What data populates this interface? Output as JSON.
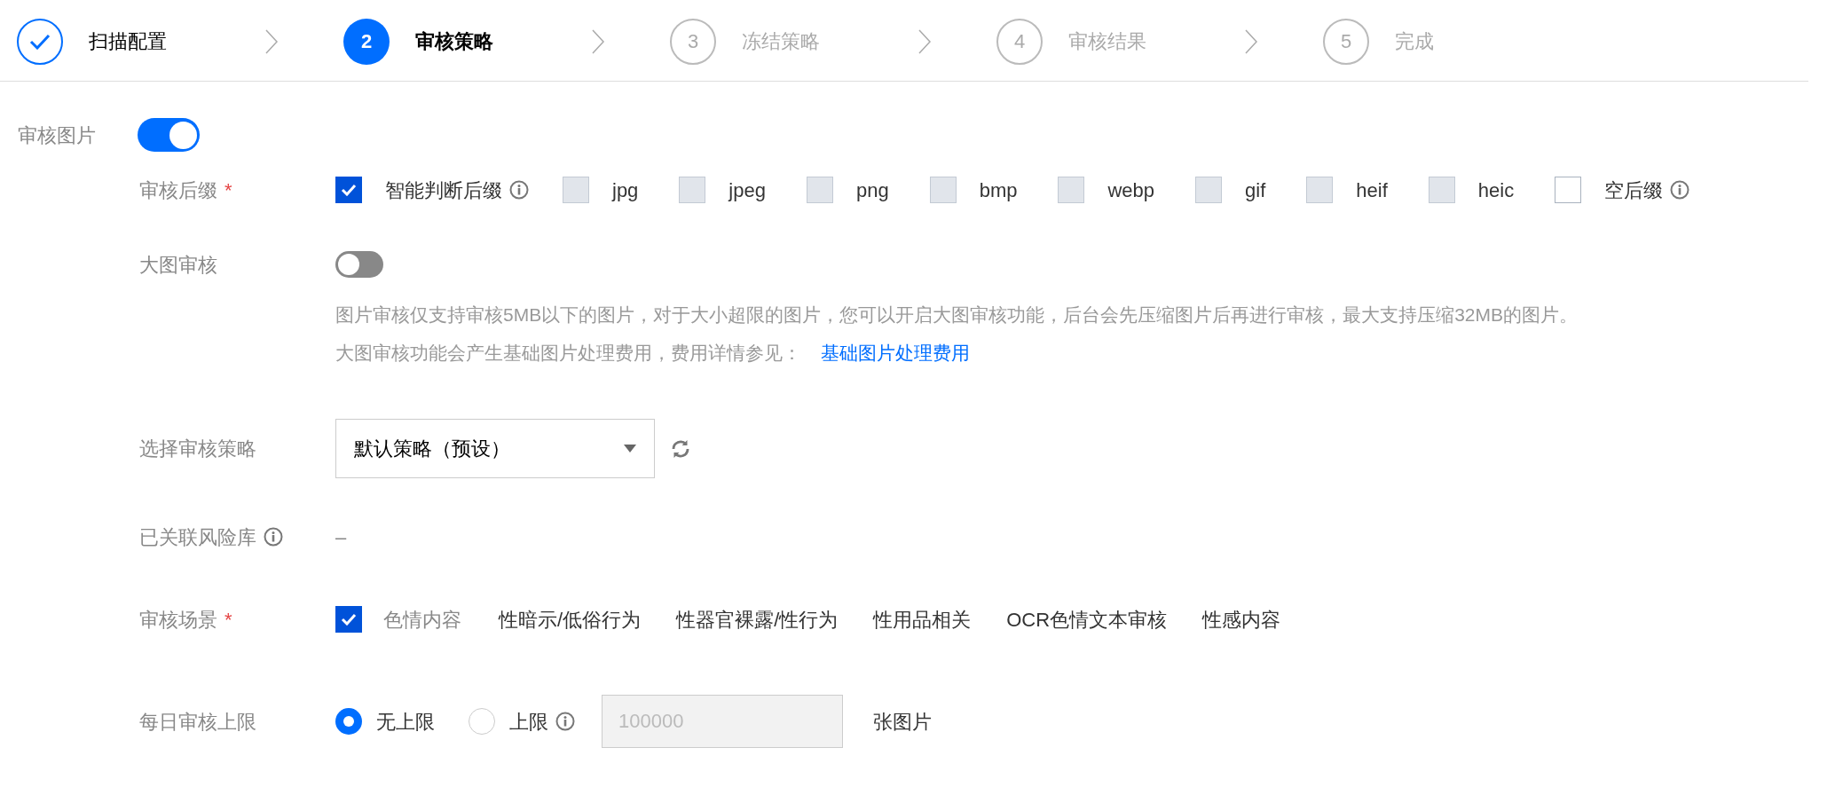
{
  "steps": [
    {
      "label": "扫描配置",
      "done": true,
      "selected": false
    },
    {
      "number": "2",
      "label": "审核策略",
      "done": false,
      "selected": true
    },
    {
      "number": "3",
      "label": "冻结策略",
      "done": false,
      "selected": false
    },
    {
      "number": "4",
      "label": "审核结果",
      "done": false,
      "selected": false
    },
    {
      "number": "5",
      "label": "完成",
      "done": false,
      "selected": false
    }
  ],
  "section": {
    "label": "审核图片",
    "on": true
  },
  "suffix": {
    "label": "审核后缀",
    "required": "*",
    "options": [
      {
        "label": "智能判断后缀",
        "checked": true,
        "disabled": false,
        "info": true
      },
      {
        "label": "jpg",
        "checked": false,
        "disabled": true,
        "info": false
      },
      {
        "label": "jpeg",
        "checked": false,
        "disabled": true,
        "info": false
      },
      {
        "label": "png",
        "checked": false,
        "disabled": true,
        "info": false
      },
      {
        "label": "bmp",
        "checked": false,
        "disabled": true,
        "info": false
      },
      {
        "label": "webp",
        "checked": false,
        "disabled": true,
        "info": false
      },
      {
        "label": "gif",
        "checked": false,
        "disabled": true,
        "info": false
      },
      {
        "label": "heif",
        "checked": false,
        "disabled": true,
        "info": false
      },
      {
        "label": "heic",
        "checked": false,
        "disabled": true,
        "info": false
      },
      {
        "label": "空后缀",
        "checked": false,
        "disabled": false,
        "info": true
      }
    ]
  },
  "large_image": {
    "label": "大图审核",
    "on": false,
    "hint": "图片审核仅支持审核5MB以下的图片，对于大小超限的图片，您可以开启大图审核功能，后台会先压缩图片后再进行审核，最大支持压缩32MB的图片。",
    "note": "大图审核功能会产生基础图片处理费用，费用详情参见：",
    "link": "基础图片处理费用"
  },
  "policy": {
    "label": "选择审核策略",
    "value": "默认策略（预设）"
  },
  "risk_library": {
    "label": "已关联风险库",
    "value": "–"
  },
  "scenes": {
    "label": "审核场景",
    "required": "*",
    "items": [
      {
        "kind": "checkbox",
        "label": "色情内容",
        "checked": true
      },
      {
        "kind": "text",
        "label": "性暗示/低俗行为"
      },
      {
        "kind": "text",
        "label": "性器官裸露/性行为"
      },
      {
        "kind": "text",
        "label": "性用品相关"
      },
      {
        "kind": "text",
        "label": "OCR色情文本审核"
      },
      {
        "kind": "text",
        "label": "性感内容"
      }
    ]
  },
  "daily_limit": {
    "label": "每日审核上限",
    "options": [
      {
        "label": "无上限",
        "selected": true,
        "info": false
      },
      {
        "label": "上限",
        "selected": false,
        "info": true
      }
    ],
    "input": {
      "placeholder": "100000"
    },
    "unit": "张图片"
  }
}
